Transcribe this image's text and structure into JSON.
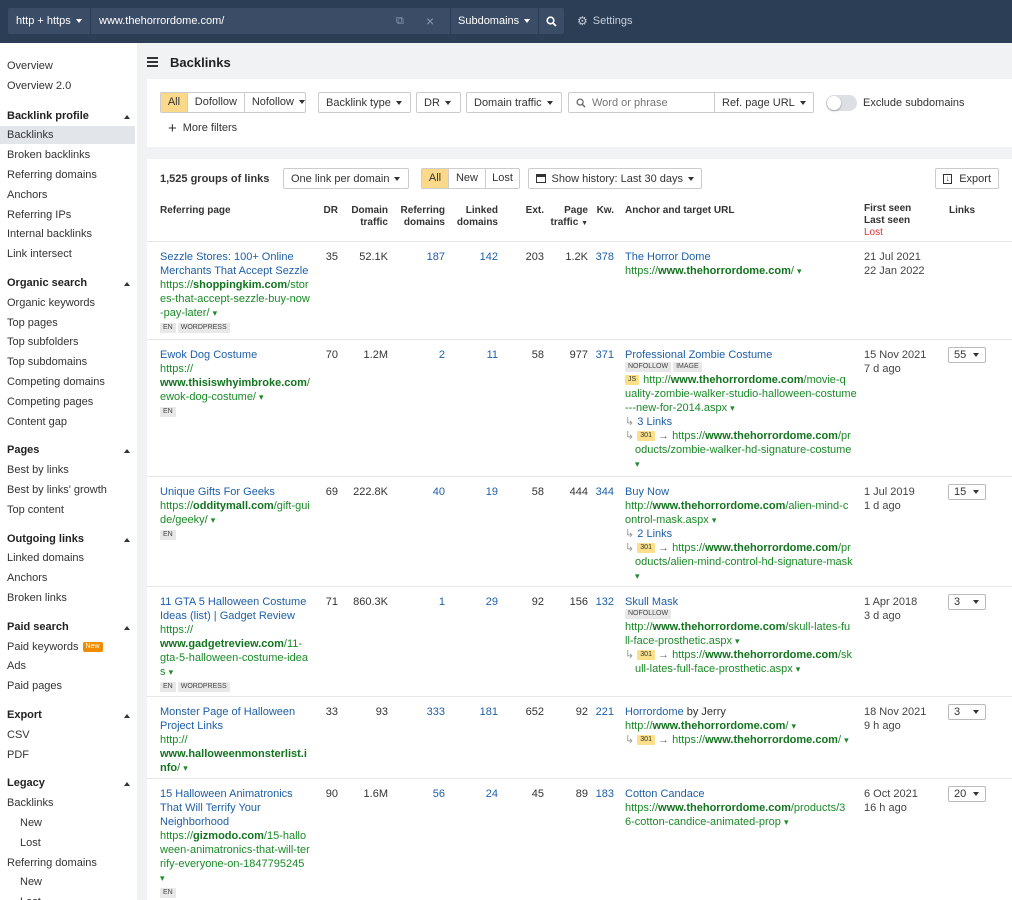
{
  "topbar": {
    "protocol": "http + https",
    "url": "www.thehorrordome.com/",
    "mode": "Subdomains",
    "settings": "Settings"
  },
  "sidebar": {
    "top": [
      "Overview",
      "Overview 2.0"
    ],
    "sections": [
      {
        "title": "Backlink profile",
        "items": [
          "Backlinks",
          "Broken backlinks",
          "Referring domains",
          "Anchors",
          "Referring IPs",
          "Internal backlinks",
          "Link intersect"
        ]
      },
      {
        "title": "Organic search",
        "items": [
          "Organic keywords",
          "Top pages",
          "Top subfolders",
          "Top subdomains",
          "Competing domains",
          "Competing pages",
          "Content gap"
        ]
      },
      {
        "title": "Pages",
        "items": [
          "Best by links",
          "Best by links' growth",
          "Top content"
        ]
      },
      {
        "title": "Outgoing links",
        "items": [
          "Linked domains",
          "Anchors",
          "Broken links"
        ]
      },
      {
        "title": "Paid search",
        "items": [
          "Paid keywords",
          "Ads",
          "Paid pages"
        ]
      },
      {
        "title": "Export",
        "items": [
          "CSV",
          "PDF"
        ]
      },
      {
        "title": "Legacy",
        "items": [
          "Backlinks",
          "New",
          "Lost",
          "Referring domains",
          "New",
          "Lost"
        ]
      }
    ],
    "new_badge": "New"
  },
  "page": {
    "title": "Backlinks"
  },
  "filters": {
    "all": "All",
    "dofollow": "Dofollow",
    "nofollow": "Nofollow",
    "backlink_type": "Backlink type",
    "dr": "DR",
    "domain_traffic": "Domain traffic",
    "search_placeholder": "Word or phrase",
    "ref_page_url": "Ref. page URL",
    "exclude_subdomains": "Exclude subdomains",
    "more_filters": "More filters"
  },
  "results": {
    "count": "1,525 groups of links",
    "grouping": "One link per domain",
    "tabs": [
      "All",
      "New",
      "Lost"
    ],
    "history": "Show history: Last 30 days",
    "export": "Export",
    "headers": {
      "referring_page": "Referring page",
      "dr": "DR",
      "domain_traffic": "Domain traffic",
      "referring_domains": "Referring domains",
      "linked_domains": "Linked domains",
      "ext": "Ext.",
      "page_traffic": "Page traffic",
      "kw": "Kw.",
      "anchor": "Anchor and target URL",
      "first_seen": "First seen",
      "last_seen": "Last seen",
      "lost": "Lost",
      "links": "Links"
    }
  },
  "rows": [
    {
      "title": "Sezzle Stores: 100+ Online Merchants That Accept Sezzle",
      "url_lines": [
        "https://<b>shoppingkim.com</b>/stor",
        "es-that-accept-sezzle-buy-now",
        "-pay-later/ ▾"
      ],
      "tags": [
        "EN",
        "WORDPRESS"
      ],
      "dr": "35",
      "domain_traffic": "52.1K",
      "ref_domains": "187",
      "linked_domains": "142",
      "ext": "203",
      "page_traffic": "1.2K",
      "kw": "378",
      "anchor": "The Horror Dome",
      "anchor_suffix": "",
      "anchor_tags": [],
      "js": false,
      "target_lines": [
        "https://<b>www.thehorrordome.com</b>/ ▾"
      ],
      "links_count": "",
      "redirects": [],
      "first_seen": "21 Jul 2021",
      "last_seen": "22 Jan 2022",
      "links_select": ""
    },
    {
      "title": "Ewok Dog Costume",
      "url_lines": [
        "https://",
        "<b>www.thisiswhyimbroke.com</b>/",
        "ewok-dog-costume/ ▾"
      ],
      "tags": [
        "EN"
      ],
      "dr": "70",
      "domain_traffic": "1.2M",
      "ref_domains": "2",
      "linked_domains": "11",
      "ext": "58",
      "page_traffic": "977",
      "kw": "371",
      "anchor": "Professional Zombie Costume",
      "anchor_suffix": "",
      "anchor_tags": [
        "NOFOLLOW",
        "IMAGE"
      ],
      "js": true,
      "target_lines": [
        "http://<b>www.thehorrordome.com</b>/movie-q",
        "uality-zombie-walker-studio-halloween-costume",
        "---new-for-2014.aspx ▾"
      ],
      "links_count": "3 Links",
      "redirects": [
        {
          "code": "301",
          "lines": [
            "https://<b>www.thehorrordome.com</b>/pr",
            "oducts/zombie-walker-hd-signature-costume",
            "▾"
          ]
        }
      ],
      "first_seen": "15 Nov 2021",
      "last_seen": "7 d ago",
      "links_select": "55"
    },
    {
      "title": "Unique Gifts For Geeks",
      "url_lines": [
        "https://<b>odditymall.com</b>/gift-gui",
        "de/geeky/ ▾"
      ],
      "tags": [
        "EN"
      ],
      "dr": "69",
      "domain_traffic": "222.8K",
      "ref_domains": "40",
      "linked_domains": "19",
      "ext": "58",
      "page_traffic": "444",
      "kw": "344",
      "anchor": "Buy Now",
      "anchor_suffix": "",
      "anchor_tags": [],
      "js": false,
      "target_lines": [
        "http://<b>www.thehorrordome.com</b>/alien-mind-c",
        "ontrol-mask.aspx ▾"
      ],
      "links_count": "2 Links",
      "redirects": [
        {
          "code": "301",
          "lines": [
            "https://<b>www.thehorrordome.com</b>/pr",
            "oducts/alien-mind-control-hd-signature-mask",
            "▾"
          ]
        }
      ],
      "first_seen": "1 Jul 2019",
      "last_seen": "1 d ago",
      "links_select": "15"
    },
    {
      "title": "11 GTA 5 Halloween Costume Ideas (list) | Gadget Review",
      "url_lines": [
        "https://",
        "<b>www.gadgetreview.com</b>/11-",
        "gta-5-halloween-costume-idea",
        "s ▾"
      ],
      "tags": [
        "EN",
        "WORDPRESS"
      ],
      "dr": "71",
      "domain_traffic": "860.3K",
      "ref_domains": "1",
      "linked_domains": "29",
      "ext": "92",
      "page_traffic": "156",
      "kw": "132",
      "anchor": "Skull Mask",
      "anchor_suffix": "",
      "anchor_tags": [
        "NOFOLLOW"
      ],
      "js": false,
      "target_lines": [
        "http://<b>www.thehorrordome.com</b>/skull-lates-fu",
        "ll-face-prosthetic.aspx ▾"
      ],
      "links_count": "",
      "redirects": [
        {
          "code": "301",
          "lines": [
            "https://<b>www.thehorrordome.com</b>/sk",
            "ull-lates-full-face-prosthetic.aspx ▾"
          ]
        }
      ],
      "first_seen": "1 Apr 2018",
      "last_seen": "3 d ago",
      "links_select": "3"
    },
    {
      "title": "Monster Page of Halloween Project Links",
      "url_lines": [
        "http://",
        "<b>www.halloweenmonsterlist.i</b>",
        "<b>nfo</b>/ ▾"
      ],
      "tags": [],
      "dr": "33",
      "domain_traffic": "93",
      "ref_domains": "333",
      "linked_domains": "181",
      "ext": "652",
      "page_traffic": "92",
      "kw": "221",
      "anchor": "Horrordome",
      "anchor_suffix": " by Jerry",
      "anchor_tags": [],
      "js": false,
      "target_lines": [
        "http://<b>www.thehorrordome.com</b>/ ▾"
      ],
      "links_count": "",
      "redirects": [
        {
          "code": "301",
          "lines": [
            "https://<b>www.thehorrordome.com</b>/ ▾"
          ]
        }
      ],
      "first_seen": "18 Nov 2021",
      "last_seen": "9 h ago",
      "links_select": "3"
    },
    {
      "title": "15 Halloween Animatronics That Will Terrify Your Neighborhood",
      "url_lines": [
        "https://<b>gizmodo.com</b>/15-hallo",
        "ween-animatronics-that-will-ter",
        "rify-everyone-on-1847795245",
        "▾"
      ],
      "tags": [
        "EN"
      ],
      "dr": "90",
      "domain_traffic": "1.6M",
      "ref_domains": "56",
      "linked_domains": "24",
      "ext": "45",
      "page_traffic": "89",
      "kw": "183",
      "anchor": "Cotton Candace",
      "anchor_suffix": "",
      "anchor_tags": [],
      "js": false,
      "target_lines": [
        "https://<b>www.thehorrordome.com</b>/products/3",
        "6-cotton-candice-animated-prop ▾"
      ],
      "links_count": "",
      "redirects": [],
      "first_seen": "6 Oct 2021",
      "last_seen": "16 h ago",
      "links_select": "20"
    }
  ],
  "colors": {
    "topbar": "#2c3e56",
    "accent_orange": "#f08c00",
    "tab_active": "#fbd98a",
    "link": "#1e5fa8",
    "url_green": "#1a8a27",
    "lost_red": "#e03131"
  }
}
